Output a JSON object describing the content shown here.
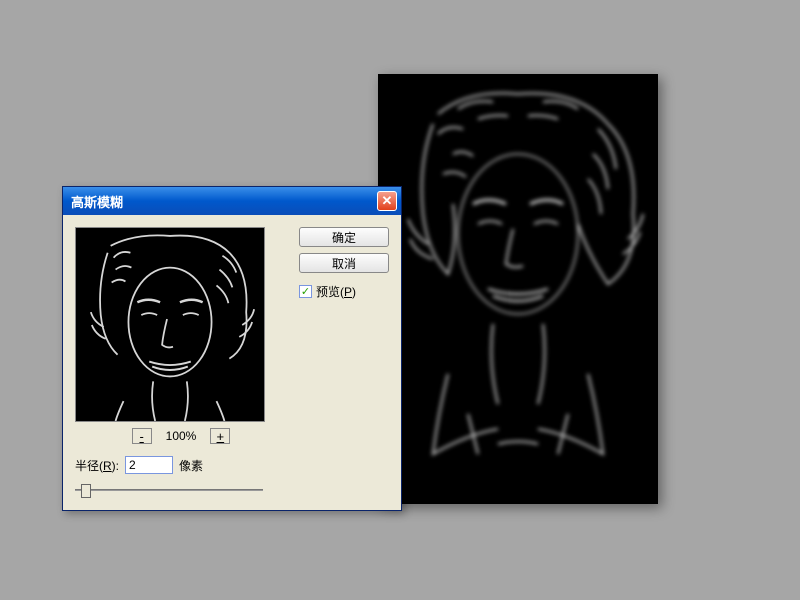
{
  "dialog": {
    "title": "高斯模糊",
    "ok_label": "确定",
    "cancel_label": "取消",
    "preview_label": "预览(",
    "preview_key": "P",
    "preview_label_end": ")",
    "preview_checked": "✓",
    "zoom_minus": "-",
    "zoom_plus": "+",
    "zoom_value": "100%",
    "radius_label": "半径(",
    "radius_key": "R",
    "radius_label_end": "):",
    "radius_value": "2",
    "radius_unit": "像素",
    "close_symbol": "✕"
  }
}
